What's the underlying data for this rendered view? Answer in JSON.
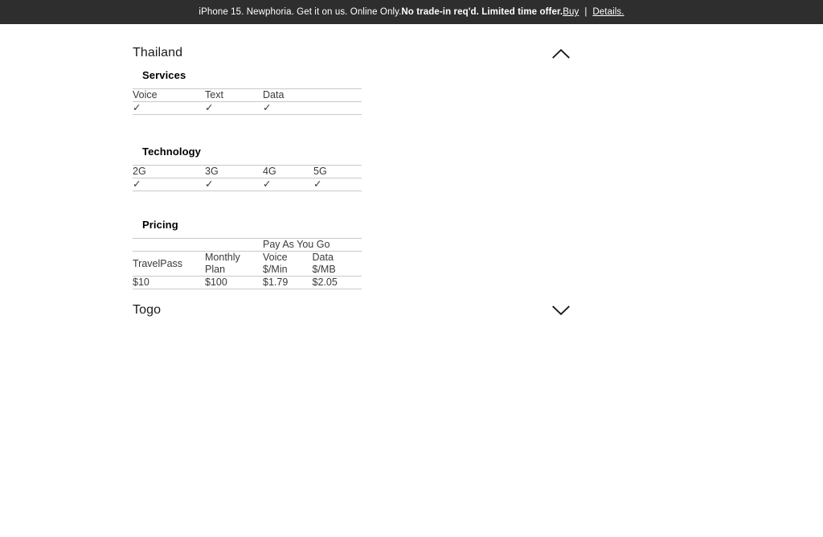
{
  "banner": {
    "text_light_1": "iPhone 15. Newphoria. Get it on us. Online Only. ",
    "text_bold": "No trade-in req'd. Limited time offer.",
    "space": " ",
    "buy_label": "Buy",
    "separator": "|",
    "details_label": "Details.",
    "background_color": "#2e2e2e",
    "text_color": "#ffffff"
  },
  "country": {
    "name": "Thailand",
    "toggle_icon": "chevron-up-icon",
    "expanded": true
  },
  "sections": {
    "services": {
      "title": "Services",
      "headers": [
        "Voice",
        "Text",
        "Data"
      ],
      "values": [
        "✓",
        "✓",
        "✓"
      ]
    },
    "technology": {
      "title": "Technology",
      "headers": [
        "2G",
        "3G",
        "4G",
        "5G"
      ],
      "values": [
        "✓",
        "✓",
        "✓",
        "✓"
      ]
    },
    "pricing": {
      "title": "Pricing",
      "group_header": "Pay As You Go",
      "headers": [
        {
          "line1": "TravelPass",
          "line2": ""
        },
        {
          "line1": "Monthly",
          "line2": "Plan"
        },
        {
          "line1": "Voice",
          "line2": "$/Min"
        },
        {
          "line1": "Data",
          "line2": "$/MB"
        }
      ],
      "values": [
        "$10",
        "$100",
        "$1.79",
        "$2.05"
      ]
    }
  },
  "next_country": {
    "name": "Togo",
    "toggle_icon": "chevron-down-icon",
    "expanded": false
  }
}
